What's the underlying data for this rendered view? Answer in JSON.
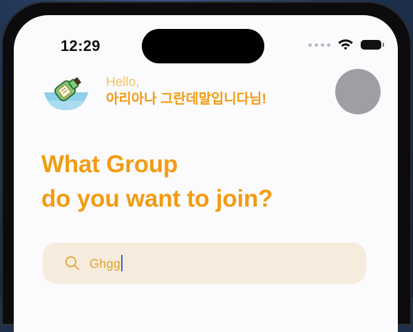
{
  "status_bar": {
    "time": "12:29",
    "icons": [
      "signal-dots-icon",
      "wifi-icon",
      "battery-icon"
    ]
  },
  "header": {
    "logo_icon": "message-in-a-bottle-icon",
    "greeting": "Hello,",
    "user_name": "아리아나 그란데말입니다님!",
    "avatar": "avatar"
  },
  "main": {
    "headline_line1": "What Group",
    "headline_line2": "do you want to join?"
  },
  "search": {
    "value": "Ghgg",
    "icon": "search-icon"
  },
  "colors": {
    "accent": "#F39B12",
    "greeting": "#F3C15F",
    "search_bg": "#F6ECDD",
    "search_text": "#E3A230",
    "avatar": "#9F9EA3",
    "caret": "#3160D6"
  }
}
